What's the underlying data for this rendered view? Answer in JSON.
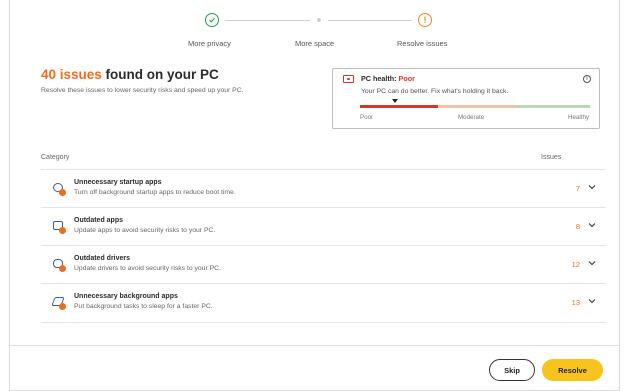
{
  "stepper": {
    "steps": [
      {
        "label": "More privacy",
        "state": "done"
      },
      {
        "label": "More space",
        "state": "pending"
      },
      {
        "label": "Resolve issues",
        "state": "warning"
      }
    ]
  },
  "header": {
    "count": "40 issues",
    "title_rest": " found on your PC",
    "subtitle": "Resolve these issues to lower security risks and speed up your PC."
  },
  "health": {
    "title_prefix": "PC health: ",
    "status": "Poor",
    "description": "Your PC can do better. Fix what's holding it back.",
    "scale": [
      "Poor",
      "Moderate",
      "Healthy"
    ],
    "level": 0.15,
    "colors": {
      "poor": "#d9342b",
      "moderate": "#efc3a6",
      "healthy": "#b8d8b8"
    }
  },
  "table": {
    "col_category": "Category",
    "col_issues": "Issues",
    "rows": [
      {
        "title": "Unnecessary startup apps",
        "desc": "Turn off background startup apps to reduce boot time.",
        "count": "7",
        "icon": "startup-apps-icon"
      },
      {
        "title": "Outdated apps",
        "desc": "Update apps to avoid security risks to your PC.",
        "count": "8",
        "icon": "outdated-apps-icon"
      },
      {
        "title": "Outdated drivers",
        "desc": "Update drivers to avoid security risks to your PC.",
        "count": "12",
        "icon": "outdated-drivers-icon"
      },
      {
        "title": "Unnecessary background apps",
        "desc": "Put background tasks to sleep for a faster PC.",
        "count": "13",
        "icon": "background-apps-icon"
      }
    ]
  },
  "footer": {
    "skip_label": "Skip",
    "resolve_label": "Resolve"
  },
  "colors": {
    "accent": "#f26b1d",
    "primary_button": "#f7c31c",
    "success": "#1fa35a"
  }
}
